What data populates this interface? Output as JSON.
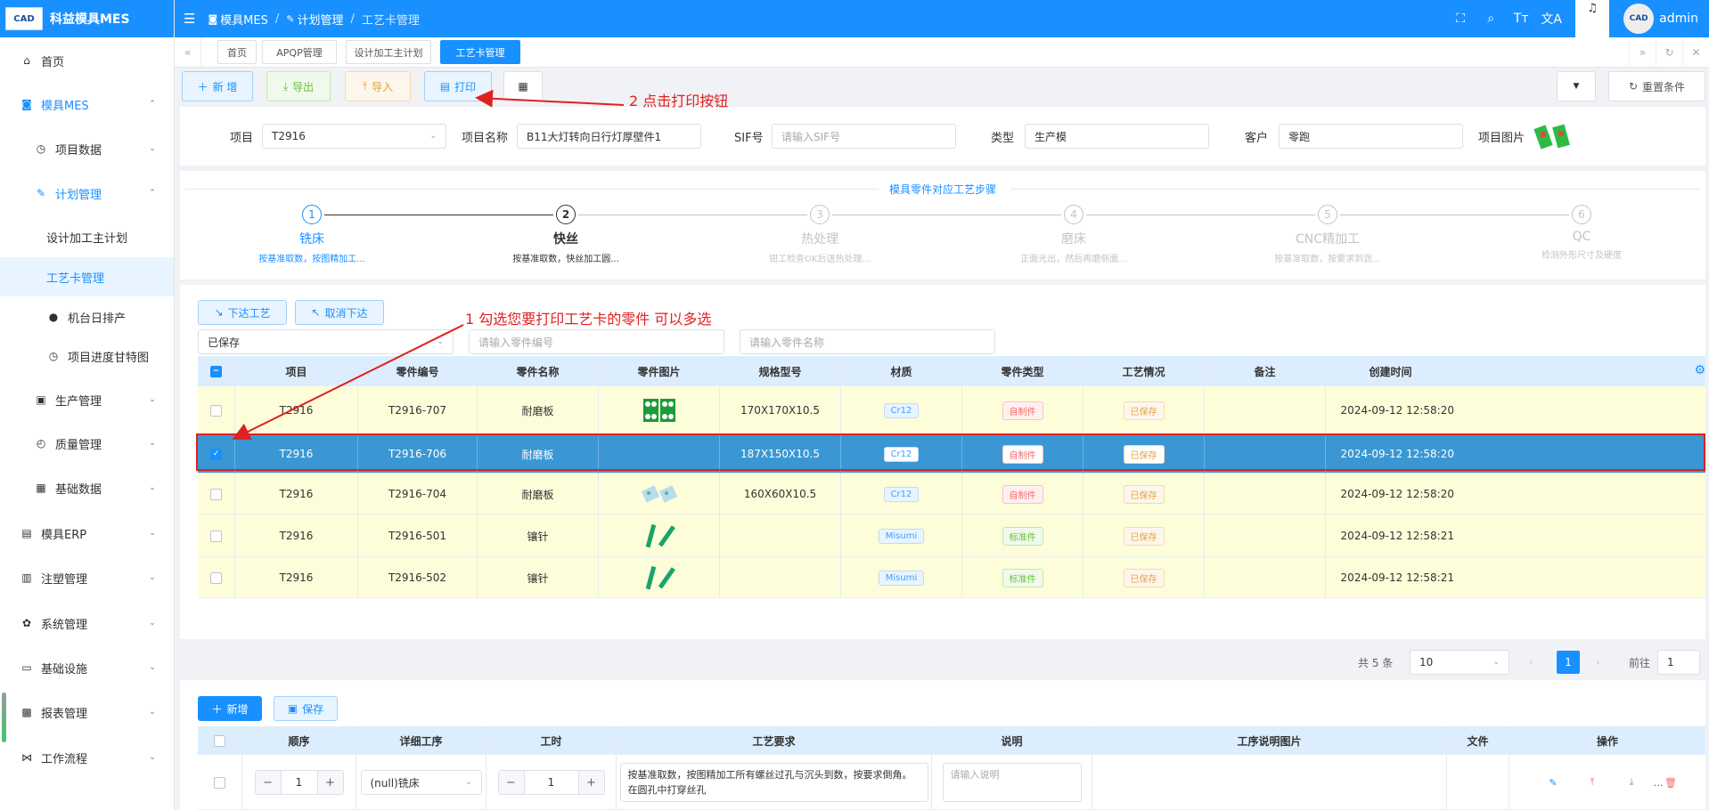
{
  "app": {
    "title": "科益模具MES",
    "logo_text": "CAD"
  },
  "sidebar": {
    "items": [
      {
        "label": "首页",
        "icon": "home-icon",
        "glyph": "⌂"
      },
      {
        "label": "模具MES",
        "icon": "mes-icon",
        "glyph": "◙"
      },
      {
        "label": "项目数据",
        "icon": "clock-icon",
        "glyph": "◷"
      },
      {
        "label": "计划管理",
        "icon": "edit-icon",
        "glyph": "✎"
      },
      {
        "label": "设计加工主计划",
        "icon": "",
        "glyph": ""
      },
      {
        "label": "工艺卡管理",
        "icon": "",
        "glyph": ""
      },
      {
        "label": "机台日排产",
        "icon": "user-icon",
        "glyph": "●"
      },
      {
        "label": "项目进度甘特图",
        "icon": "clock-icon",
        "glyph": "◷"
      },
      {
        "label": "生产管理",
        "icon": "factory-icon",
        "glyph": "▣"
      },
      {
        "label": "质量管理",
        "icon": "timer-icon",
        "glyph": "◴"
      },
      {
        "label": "基础数据",
        "icon": "calendar-icon",
        "glyph": "▦"
      },
      {
        "label": "模具ERP",
        "icon": "erp-icon",
        "glyph": "▤"
      },
      {
        "label": "注塑管理",
        "icon": "injection-icon",
        "glyph": "▥"
      },
      {
        "label": "系统管理",
        "icon": "gear-icon",
        "glyph": "✿"
      },
      {
        "label": "基础设施",
        "icon": "monitor-icon",
        "glyph": "▭"
      },
      {
        "label": "报表管理",
        "icon": "chart-icon",
        "glyph": "▩"
      },
      {
        "label": "工作流程",
        "icon": "flow-icon",
        "glyph": "⋈"
      }
    ]
  },
  "topbar": {
    "breadcrumb": [
      "模具MES",
      "计划管理",
      "工艺卡管理"
    ],
    "user": "admin",
    "icons": [
      "fullscreen-icon",
      "search-icon",
      "font-size-icon",
      "translate-icon",
      "bell-icon"
    ],
    "icon_glyphs": [
      "⛶",
      "⌕",
      "Tт",
      "文A",
      "♫"
    ]
  },
  "tags": [
    "首页",
    "APQP管理",
    "设计加工主计划",
    "工艺卡管理"
  ],
  "toolbar": {
    "add": "新 增",
    "export": "导出",
    "import": "导入",
    "print": "打印",
    "reset": "重置条件"
  },
  "form": {
    "project_label": "项目",
    "project_value": "T2916",
    "name_label": "项目名称",
    "name_value": "B11大灯转向日行灯厚壁件1",
    "sif_label": "SIF号",
    "sif_placeholder": "请输入SIF号",
    "type_label": "类型",
    "type_value": "生产模",
    "customer_label": "客户",
    "customer_value": "零跑",
    "image_label": "项目图片"
  },
  "steps": {
    "title": "模具零件对应工艺步骤",
    "items": [
      {
        "n": "1",
        "title": "铣床",
        "desc": "按基准取数，按图精加工...",
        "state": "done"
      },
      {
        "n": "2",
        "title": "快丝",
        "desc": "按基准取数，快丝加工圆...",
        "state": "current"
      },
      {
        "n": "3",
        "title": "热处理",
        "desc": "钳工检查OK后送热处理...",
        "state": "wait"
      },
      {
        "n": "4",
        "title": "磨床",
        "desc": "正面光出，然后再磨侧面...",
        "state": "wait"
      },
      {
        "n": "5",
        "title": "CNC精加工",
        "desc": "按基准取数，按要求到沥...",
        "state": "wait"
      },
      {
        "n": "6",
        "title": "QC",
        "desc": "检测外形尺寸及硬度",
        "state": "wait"
      }
    ]
  },
  "parts": {
    "issue_btn": "下达工艺",
    "cancel_btn": "取消下达",
    "status_filter": "已保存",
    "code_placeholder": "请输入零件编号",
    "name_placeholder": "请输入零件名称",
    "columns": [
      "项目",
      "零件编号",
      "零件名称",
      "零件图片",
      "规格型号",
      "材质",
      "零件类型",
      "工艺情况",
      "备注",
      "创建时间"
    ],
    "rows": [
      {
        "project": "T2916",
        "code": "T2916-707",
        "name": "耐磨板",
        "spec": "170X170X10.5",
        "material": "Cr12",
        "ptype": "自制件",
        "status": "已保存",
        "remark": "",
        "created": "2024-09-12 12:58:20",
        "img": "green",
        "selected": false
      },
      {
        "project": "T2916",
        "code": "T2916-706",
        "name": "耐磨板",
        "spec": "187X150X10.5",
        "material": "Cr12",
        "ptype": "自制件",
        "status": "已保存",
        "remark": "",
        "created": "2024-09-12 12:58:20",
        "img": "none",
        "selected": true
      },
      {
        "project": "T2916",
        "code": "T2916-704",
        "name": "耐磨板",
        "spec": "160X60X10.5",
        "material": "Cr12",
        "ptype": "自制件",
        "status": "已保存",
        "remark": "",
        "created": "2024-09-12 12:58:20",
        "img": "blue",
        "selected": false
      },
      {
        "project": "T2916",
        "code": "T2916-501",
        "name": "镶针",
        "spec": "",
        "material": "Misumi",
        "ptype": "标准件",
        "status": "已保存",
        "remark": "",
        "created": "2024-09-12 12:58:21",
        "img": "pins",
        "selected": false
      },
      {
        "project": "T2916",
        "code": "T2916-502",
        "name": "镶针",
        "spec": "",
        "material": "Misumi",
        "ptype": "标准件",
        "status": "已保存",
        "remark": "",
        "created": "2024-09-12 12:58:21",
        "img": "pins",
        "selected": false
      }
    ]
  },
  "pager": {
    "total": "共 5 条",
    "size": "10",
    "page": "1",
    "goto_label": "前往",
    "goto_value": "1"
  },
  "annotations": {
    "a1": "1 勾选您要打印工艺卡的零件 可以多选",
    "a2": "2 点击打印按钮"
  },
  "process": {
    "add": "新增",
    "save": "保存",
    "columns": [
      "顺序",
      "详细工序",
      "工时",
      "工艺要求",
      "说明",
      "工序说明图片",
      "文件",
      "操作"
    ],
    "row": {
      "order": "1",
      "step": "(null)铣床",
      "hours": "1",
      "requirement": "按基准取数，按图精加工所有螺丝过孔与沉头到数，按要求倒角。在圆孔中打穿丝孔",
      "note_placeholder": "请输入说明"
    }
  },
  "colors": {
    "primary": "#1890ff",
    "annotation": "#e02020",
    "row_bg": "#fdfdd9",
    "selected_row": "#3a97d4"
  }
}
